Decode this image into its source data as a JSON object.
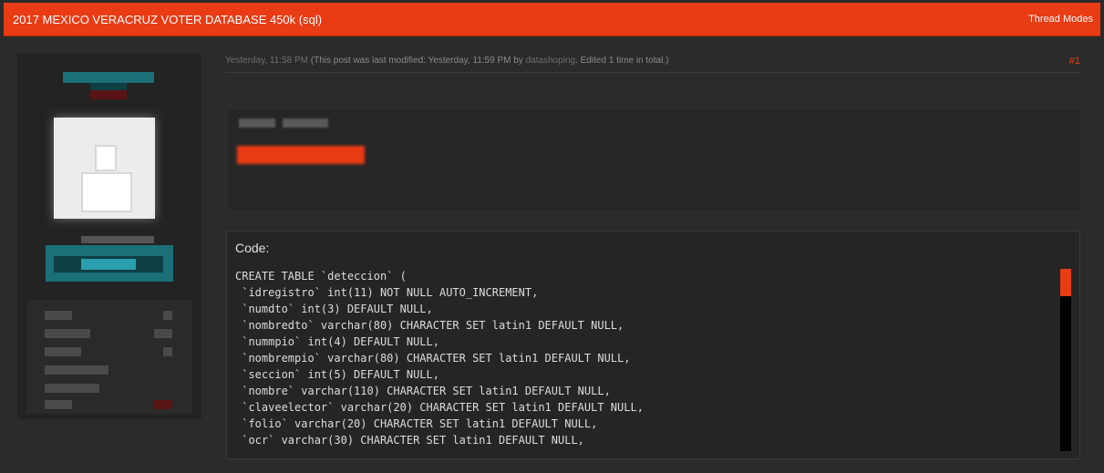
{
  "thread": {
    "title": "2017 MEXICO VERACRUZ VOTER DATABASE 450k (sql)",
    "modes_label": "Thread Modes"
  },
  "post": {
    "date": "Yesterday, 11:58 PM",
    "modified_prefix": "(This post was last modified: Yesterday, 11:59 PM by",
    "editor": "datashoping",
    "modified_suffix": ". Edited 1 time in total.)",
    "number": "#1"
  },
  "code": {
    "title": "Code:",
    "lines": [
      "CREATE TABLE `deteccion` (",
      " `idregistro` int(11) NOT NULL AUTO_INCREMENT,",
      " `numdto` int(3) DEFAULT NULL,",
      " `nombredto` varchar(80) CHARACTER SET latin1 DEFAULT NULL,",
      " `nummpio` int(4) DEFAULT NULL,",
      " `nombrempio` varchar(80) CHARACTER SET latin1 DEFAULT NULL,",
      " `seccion` int(5) DEFAULT NULL,",
      " `nombre` varchar(110) CHARACTER SET latin1 DEFAULT NULL,",
      " `claveelector` varchar(20) CHARACTER SET latin1 DEFAULT NULL,",
      " `folio` varchar(20) CHARACTER SET latin1 DEFAULT NULL,",
      " `ocr` varchar(30) CHARACTER SET latin1 DEFAULT NULL,"
    ]
  },
  "colors": {
    "accent": "#e93b14",
    "background": "#2b2b2b",
    "panel": "#232323",
    "teal": "#1a6f78"
  }
}
